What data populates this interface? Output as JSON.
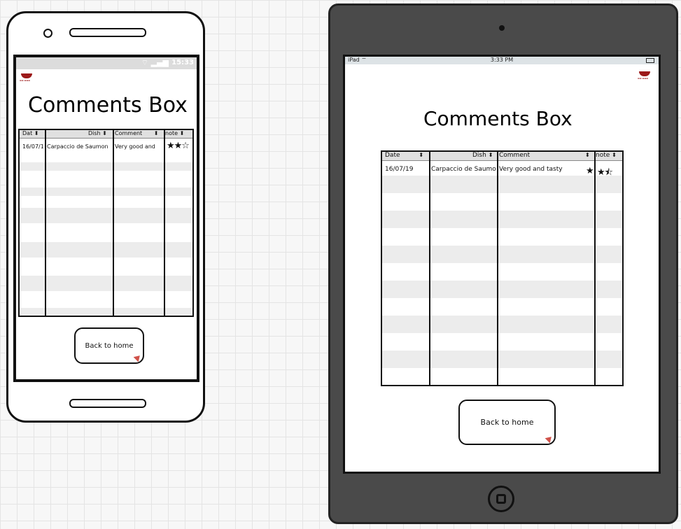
{
  "phone": {
    "status_time": "15:33",
    "status_signal": "⌔ ▂▄▆",
    "title": "Comments Box",
    "table": {
      "headers": [
        "Dat",
        "Dish",
        "Comment",
        "note"
      ],
      "rows": [
        {
          "date": "16/07/1",
          "dish": "Carpaccio de Saumon",
          "comment": "Very good and",
          "stars": "★★☆"
        }
      ]
    },
    "back_button": "Back to home"
  },
  "tablet": {
    "carrier": "iPad ⌔",
    "status_time": "3:33 PM",
    "title": "Comments Box",
    "table": {
      "headers": [
        "Date",
        "Dish",
        "Comment",
        "note"
      ],
      "rows": [
        {
          "date": "16/07/19",
          "dish": "Carpaccio de Saumon",
          "comment": "Very good and tasty",
          "star_extra": "★",
          "stars": "★⯪"
        }
      ]
    },
    "back_button": "Back to home"
  },
  "rating": {
    "filled_stars": 2.5,
    "max_stars": 3
  },
  "colors": {
    "brand_red": "#9c1a1a",
    "stripe": "#ececec",
    "button_arrow": "#d0524a"
  }
}
